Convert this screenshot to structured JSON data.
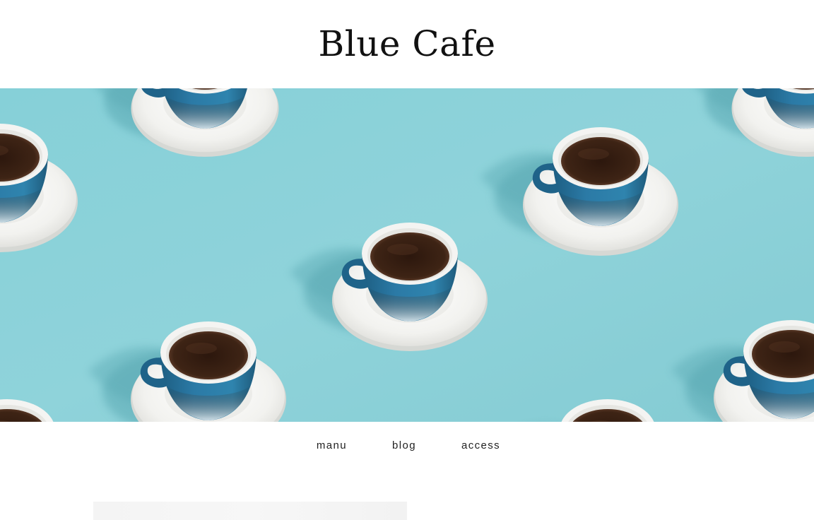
{
  "header": {
    "site_title": "Blue Cafe"
  },
  "hero": {
    "image_description": "",
    "icon": "coffee-cup-pattern",
    "background_color": "#8ad1d9",
    "cup_color": "#256f96",
    "saucer_color": "#f3f3f1",
    "coffee_color": "#3a2216"
  },
  "nav": {
    "items": [
      {
        "label": "manu"
      },
      {
        "label": "blog"
      },
      {
        "label": "access"
      }
    ]
  },
  "colors": {
    "text": "#111111",
    "background": "#ffffff"
  }
}
